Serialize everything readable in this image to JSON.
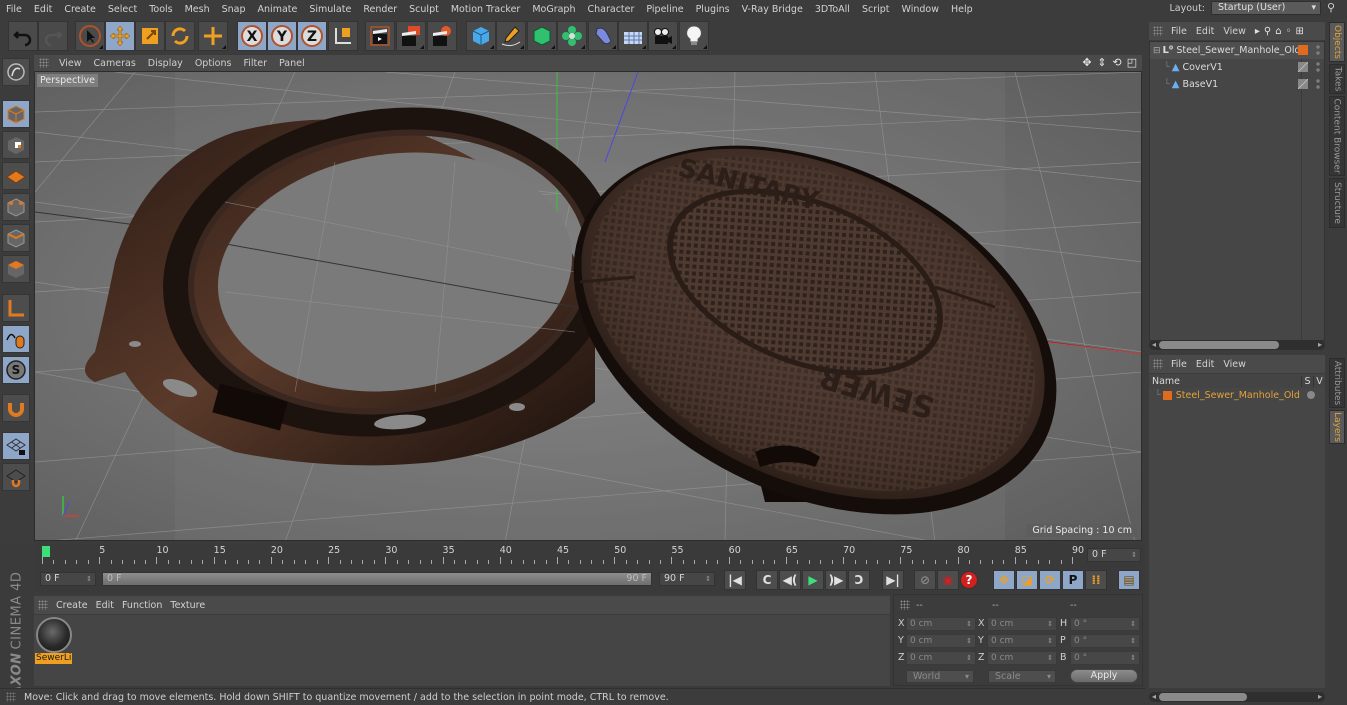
{
  "menubar": {
    "items": [
      "File",
      "Edit",
      "Create",
      "Select",
      "Tools",
      "Mesh",
      "Snap",
      "Animate",
      "Simulate",
      "Render",
      "Sculpt",
      "Motion Tracker",
      "MoGraph",
      "Character",
      "Pipeline",
      "Plugins",
      "V-Ray Bridge",
      "3DToAll",
      "Script",
      "Window",
      "Help"
    ],
    "layout_label": "Layout:",
    "layout_value": "Startup (User)",
    "search_icon": "search-icon"
  },
  "toolbar": {
    "tools": [
      {
        "name": "undo",
        "icon": "undo-icon",
        "active": false
      },
      {
        "name": "redo",
        "icon": "redo-icon",
        "active": false
      },
      {
        "name": "live-selection",
        "icon": "cursor-icon",
        "active": false
      },
      {
        "name": "move",
        "icon": "move-icon",
        "active": true
      },
      {
        "name": "scale",
        "icon": "scale-icon",
        "active": false
      },
      {
        "name": "rotate",
        "icon": "rotate-icon",
        "active": false
      },
      {
        "name": "recent-tools",
        "icon": "move-icon",
        "active": false
      },
      {
        "name": "x-axis",
        "icon": "x-axis-icon",
        "label": "X",
        "active": true
      },
      {
        "name": "y-axis",
        "icon": "y-axis-icon",
        "label": "Y",
        "active": true
      },
      {
        "name": "z-axis",
        "icon": "z-axis-icon",
        "label": "Z",
        "active": true
      },
      {
        "name": "coordinate-system",
        "icon": "world-coord-icon",
        "active": false
      },
      {
        "name": "render-view",
        "icon": "clapper-icon",
        "active": false
      },
      {
        "name": "render-picture-viewer",
        "icon": "clapper-red-icon",
        "active": false
      },
      {
        "name": "render-settings",
        "icon": "clapper-gear-icon",
        "active": false
      },
      {
        "name": "cube",
        "icon": "cube-icon",
        "active": false
      },
      {
        "name": "pen",
        "icon": "pen-icon",
        "active": false
      },
      {
        "name": "subdivision",
        "icon": "subdivision-icon",
        "active": false
      },
      {
        "name": "cloner",
        "icon": "cloner-icon",
        "active": false
      },
      {
        "name": "deformer",
        "icon": "deformer-icon",
        "active": false
      },
      {
        "name": "floor",
        "icon": "floor-icon",
        "active": false
      },
      {
        "name": "camera",
        "icon": "camera-icon",
        "active": false
      },
      {
        "name": "light",
        "icon": "light-icon",
        "active": false
      }
    ]
  },
  "left_tools": [
    {
      "name": "make-editable",
      "icon": "make-editable-icon",
      "active": false
    },
    {
      "name": "model-mode",
      "icon": "model-mode-icon",
      "active": true
    },
    {
      "name": "texture-mode",
      "icon": "texture-mode-icon",
      "active": false
    },
    {
      "name": "workplane-mode",
      "icon": "workplane-icon",
      "active": false
    },
    {
      "name": "points-mode",
      "icon": "points-mode-icon",
      "active": false
    },
    {
      "name": "edges-mode",
      "icon": "edges-mode-icon",
      "active": false
    },
    {
      "name": "polygons-mode",
      "icon": "polygons-mode-icon",
      "active": false
    },
    {
      "name": "axis-mode",
      "icon": "axis-icon",
      "active": false
    },
    {
      "name": "tweak-mode",
      "icon": "mouse-icon",
      "active": true
    },
    {
      "name": "snap",
      "icon": "snap-icon",
      "active": true
    },
    {
      "name": "magnet",
      "icon": "magnet-icon",
      "active": false
    },
    {
      "name": "workplane-lock",
      "icon": "grid-lock-icon",
      "active": true
    },
    {
      "name": "planar-workplane",
      "icon": "grid-magnet-icon",
      "active": false
    }
  ],
  "viewport": {
    "menu": [
      "View",
      "Cameras",
      "Display",
      "Options",
      "Filter",
      "Panel"
    ],
    "camera_label": "Perspective",
    "grid_spacing": "Grid Spacing : 10 cm",
    "nav_icons": [
      "move-view-icon",
      "dolly-icon",
      "rotate-view-icon",
      "maximize-icon"
    ],
    "scene_text": {
      "cover_top": "SANITARY",
      "cover_bottom": "SEWER"
    }
  },
  "object_manager": {
    "menu": [
      "File",
      "Edit",
      "View"
    ],
    "objects": [
      {
        "name": "Steel_Sewer_Manhole_Old",
        "type": "null",
        "indent": 0,
        "tag_color": "#e06a1e"
      },
      {
        "name": "CoverV1",
        "type": "polygon",
        "indent": 1
      },
      {
        "name": "BaseV1",
        "type": "polygon",
        "indent": 1
      }
    ]
  },
  "right_tabs_top": [
    {
      "label": "Objects",
      "active": true
    },
    {
      "label": "Takes",
      "active": false
    },
    {
      "label": "Content Browser",
      "active": false
    },
    {
      "label": "Structure",
      "active": false
    }
  ],
  "right_tabs_bottom": [
    {
      "label": "Attributes",
      "active": false
    },
    {
      "label": "Layers",
      "active": true
    }
  ],
  "layer_manager": {
    "menu": [
      "File",
      "Edit",
      "View"
    ],
    "columns": [
      "Name",
      "S",
      "V"
    ],
    "layers": [
      {
        "name": "Steel_Sewer_Manhole_Old",
        "color": "#e06a1e"
      }
    ]
  },
  "timeline": {
    "ticks": [
      0,
      5,
      10,
      15,
      20,
      25,
      30,
      35,
      40,
      45,
      50,
      55,
      60,
      65,
      70,
      75,
      80,
      85,
      90
    ],
    "current_frame": "0 F",
    "end_frame_display": "0 F"
  },
  "transport": {
    "start_field": "0 F",
    "range_start": "0 F",
    "range_end": "90 F",
    "end_field": "90 F",
    "buttons": [
      {
        "name": "go-to-start",
        "glyph": "|◀"
      },
      {
        "name": "previous-key",
        "glyph": "C"
      },
      {
        "name": "previous-frame",
        "glyph": "◀("
      },
      {
        "name": "play",
        "glyph": "▶"
      },
      {
        "name": "next-frame",
        "glyph": ")▶"
      },
      {
        "name": "next-key",
        "glyph": "Ɔ"
      },
      {
        "name": "go-to-end",
        "glyph": "▶|"
      }
    ],
    "key_buttons": [
      {
        "name": "record-disabled",
        "glyph": "⊘"
      },
      {
        "name": "record-active-objects",
        "glyph": "◉"
      },
      {
        "name": "autokeying",
        "glyph": "?"
      },
      {
        "name": "key-position",
        "glyph": "✥",
        "active": true
      },
      {
        "name": "key-scale",
        "glyph": "◪",
        "active": true
      },
      {
        "name": "key-rotation",
        "glyph": "⟳",
        "active": true
      },
      {
        "name": "key-parameter",
        "glyph": "P",
        "active": true
      },
      {
        "name": "key-point-level",
        "glyph": "⁞⁞",
        "active": false
      },
      {
        "name": "timeline-window",
        "glyph": "▤",
        "active": true
      }
    ]
  },
  "material_manager": {
    "menu": [
      "Create",
      "Edit",
      "Function",
      "Texture"
    ],
    "materials": [
      {
        "name": "SewerLi",
        "selected": true
      }
    ]
  },
  "brand": {
    "maker": "MAXON",
    "product": "CINEMA 4D"
  },
  "coordinates": {
    "headers": [
      "--",
      "--",
      "--"
    ],
    "rows": [
      {
        "pos_axis": "X",
        "pos": "0 cm",
        "size_axis": "X",
        "size": "0 cm",
        "rot_axis": "H",
        "rot": "0 °"
      },
      {
        "pos_axis": "Y",
        "pos": "0 cm",
        "size_axis": "Y",
        "size": "0 cm",
        "rot_axis": "P",
        "rot": "0 °"
      },
      {
        "pos_axis": "Z",
        "pos": "0 cm",
        "size_axis": "Z",
        "size": "0 cm",
        "rot_axis": "B",
        "rot": "0 °"
      }
    ],
    "mode_dropdown": "World",
    "size_dropdown": "Scale",
    "apply_label": "Apply"
  },
  "status": {
    "message": "Move: Click and drag to move elements. Hold down SHIFT to quantize movement / add to the selection in point mode, CTRL to remove."
  },
  "colors": {
    "accent_orange": "#e3a23a",
    "tool_active": "#8ea6c8",
    "playhead": "#3ce07a",
    "layer_color": "#e06a1e"
  }
}
